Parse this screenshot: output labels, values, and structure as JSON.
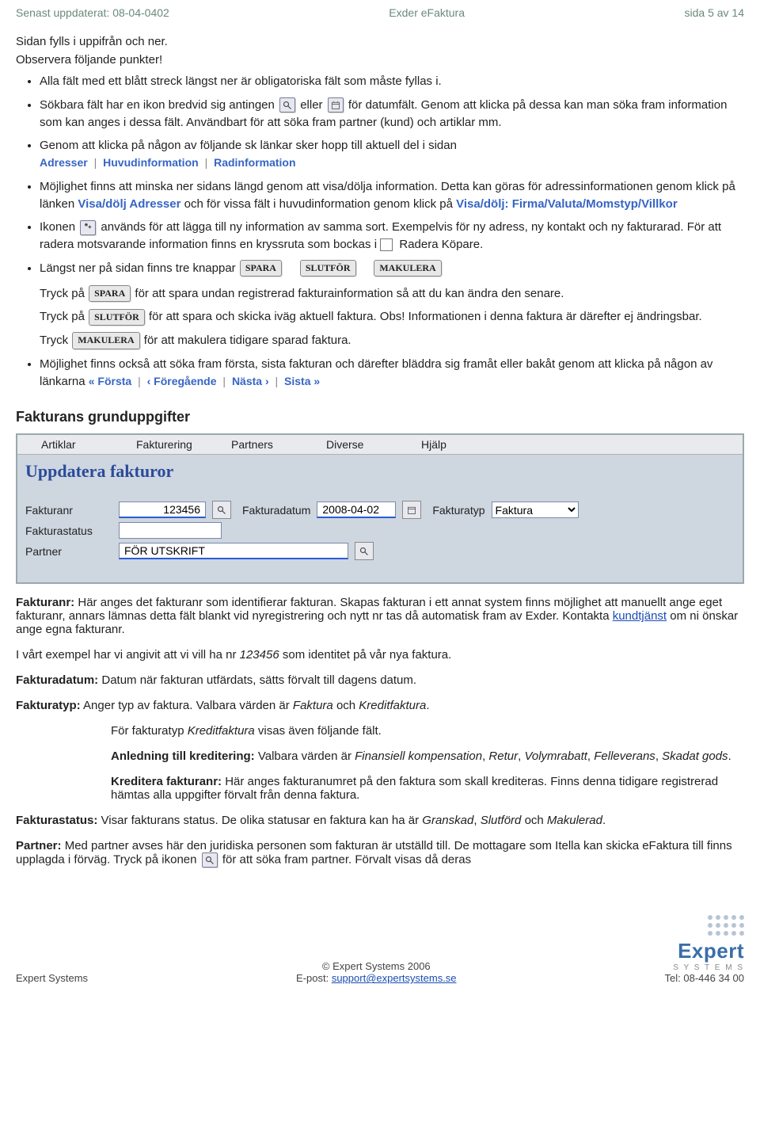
{
  "header": {
    "updated_label": "Senast uppdaterat: 08-04-0402",
    "product": "Exder eFaktura",
    "page": "sida 5 av 14"
  },
  "intro": [
    "Sidan fylls i uppifrån och ner.",
    "Observera följande punkter!"
  ],
  "bullets": {
    "b1": "Alla fält med ett blått streck längst ner är obligatoriska fält som måste fyllas i.",
    "b2a": "Sökbara fält har en ikon bredvid sig antingen ",
    "b2_or": " eller ",
    "b2b": " för datumfält. Genom att klicka på dessa kan man söka fram information som kan anges i dessa fält. Användbart för att söka fram partner (kund) och artiklar mm.",
    "b3": "Genom att klicka på någon av följande sk länkar sker hopp till aktuell del i sidan",
    "linkbar": [
      "Adresser",
      "Huvudinformation",
      "Radinformation"
    ],
    "b4a": "Möjlighet finns att minska ner sidans längd genom att visa/dölja information. Detta kan göras för adressinformationen genom klick på länken ",
    "visa_dolj_adresser": "Visa/dölj Adresser",
    "b4b": "  och för vissa fält i huvudinformation genom klick på ",
    "visa_dolj_firma": "Visa/dölj: Firma/Valuta/Momstyp/Villkor",
    "b5a": "Ikonen ",
    "b5b": " används för att lägga till ny information av samma sort. Exempelvis för ny adress, ny kontakt och ny fakturarad. För att radera motsvarande information finns en kryssruta som bockas i ",
    "radera_kopare": " Radera Köpare",
    "dot": ".",
    "b6": "Längst ner på sidan finns tre knappar ",
    "spara": "SPARA",
    "slutfor": "SLUTFÖR",
    "makulera": "MAKULERA",
    "b7a": "Tryck på ",
    "b7b": " för att spara undan registrerad fakturainformation så att du kan ändra den senare.",
    "b8a": "Tryck på ",
    "b8b": " för att spara och skicka iväg aktuell faktura. Obs! Informationen i denna faktura är därefter ej ändringsbar.",
    "b9a": "Tryck ",
    "b9b": " för att makulera tidigare sparad faktura.",
    "b10a": "Möjlighet finns också att söka fram första, sista fakturan och därefter bläddra sig framåt eller bakåt genom att klicka på någon av länkarna ",
    "navlinks": [
      "« Första",
      "‹ Föregående",
      "Nästa ›",
      "Sista »"
    ]
  },
  "section_title": "Fakturans grunduppgifter",
  "screenshot": {
    "menu": [
      "Artiklar",
      "Fakturering",
      "Partners",
      "Diverse",
      "Hjälp"
    ],
    "title": "Uppdatera fakturor",
    "labels": {
      "fakturanr": "Fakturanr",
      "fakturadatum": "Fakturadatum",
      "fakturatyp": "Fakturatyp",
      "fakturastatus": "Fakturastatus",
      "partner": "Partner"
    },
    "values": {
      "fakturanr": "123456",
      "fakturadatum": "2008-04-02",
      "fakturatyp": "Faktura",
      "fakturastatus": "",
      "partner": "FÖR UTSKRIFT"
    }
  },
  "body_text": {
    "fakturanr_label": "Fakturanr:",
    "fakturanr_text_a": " Här anges det fakturanr som identifierar fakturan. Skapas fakturan i ett annat system finns möjlighet att manuellt ange eget fakturanr, annars lämnas detta fält blankt vid nyregistrering och nytt nr tas då automatisk fram av Exder. Kontakta ",
    "kundtjanst": "kundtjänst",
    "fakturanr_text_b": " om ni önskar ange egna fakturanr.",
    "example_a": "I vårt exempel har vi angivit att vi vill ha nr ",
    "example_nr": "123456",
    "example_b": " som identitet på vår nya faktura.",
    "fakturadatum_label": "Fakturadatum:",
    "fakturadatum_text": " Datum när fakturan utfärdats, sätts förvalt till dagens datum.",
    "fakturatyp_label": "Fakturatyp:",
    "fakturatyp_text_a": " Anger typ av faktura. Valbara värden är ",
    "fakturatyp_val_a": "Faktura",
    "and": " och ",
    "fakturatyp_val_b": "Kreditfaktura",
    "ftyp_line": "För fakturatyp  ",
    "ftyp_val": "Kreditfaktura",
    "ftyp_line_b": " visas även följande fält.",
    "anledning_label": "Anledning till kreditering:",
    "anledning_a": " Valbara värden är ",
    "anl_vals": [
      "Finansiell kompensation",
      "Retur",
      "Volymrabatt",
      "Felleverans",
      "Skadat gods"
    ],
    "kreditera_label": "Kreditera fakturanr:",
    "kreditera_text": " Här anges fakturanumret på den faktura som skall krediteras. Finns denna tidigare registrerad hämtas alla uppgifter förvalt från denna faktura.",
    "fstatus_label": "Fakturastatus:",
    "fstatus_text_a": " Visar fakturans status. De olika statusar en faktura kan ha är ",
    "fstatus_vals": [
      "Granskad",
      "Slutförd",
      "Makulerad"
    ],
    "partner_label": "Partner:",
    "partner_text_a": " Med partner avses här den juridiska personen som fakturan är utställd till. De mottagare som Itella kan skicka eFaktura till finns upplagda i förväg. Tryck på ikonen ",
    "partner_text_b": " för att söka fram partner. Förvalt visas då deras"
  },
  "footer": {
    "left": "Expert Systems",
    "copyright": "© Expert Systems 2006",
    "email_label": "E-post: ",
    "email": "support@expertsystems.se",
    "tel": "Tel: 08-446 34 00",
    "logo_name": "Expert",
    "logo_sub": "S Y S T E M S"
  }
}
